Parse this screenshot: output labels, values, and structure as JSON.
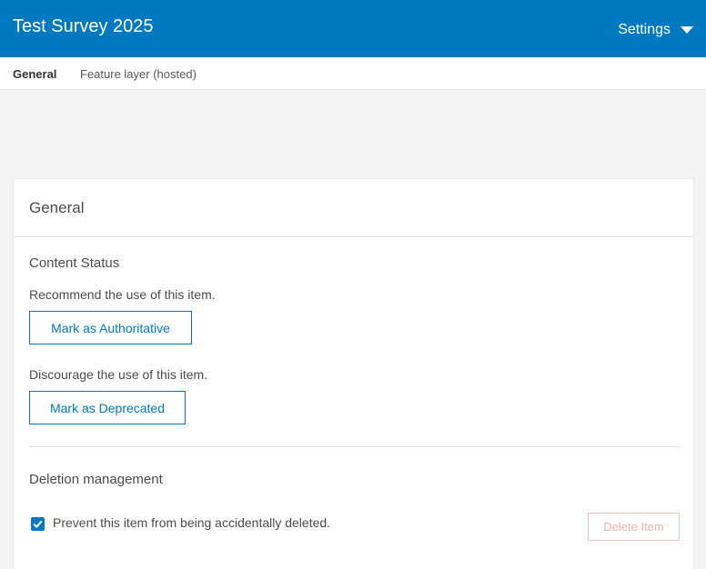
{
  "header": {
    "title": "Test Survey 2025",
    "settings_label": "Settings"
  },
  "subnav": {
    "tabs": [
      {
        "label": "General",
        "active": true
      },
      {
        "label": "Feature layer (hosted)",
        "active": false
      }
    ]
  },
  "card": {
    "heading": "General",
    "content_status": {
      "title": "Content Status",
      "recommend_text": "Recommend the use of this item.",
      "authoritative_button": "Mark as Authoritative",
      "discourage_text": "Discourage the use of this item.",
      "deprecated_button": "Mark as Deprecated"
    },
    "deletion": {
      "title": "Deletion management",
      "checkbox_label": "Prevent this item from being accidentally deleted.",
      "checkbox_checked": true,
      "delete_button": "Delete Item",
      "delete_disabled": true
    }
  },
  "colors": {
    "brand_blue": "#0079c1",
    "danger_disabled": "#f0b3aa"
  }
}
